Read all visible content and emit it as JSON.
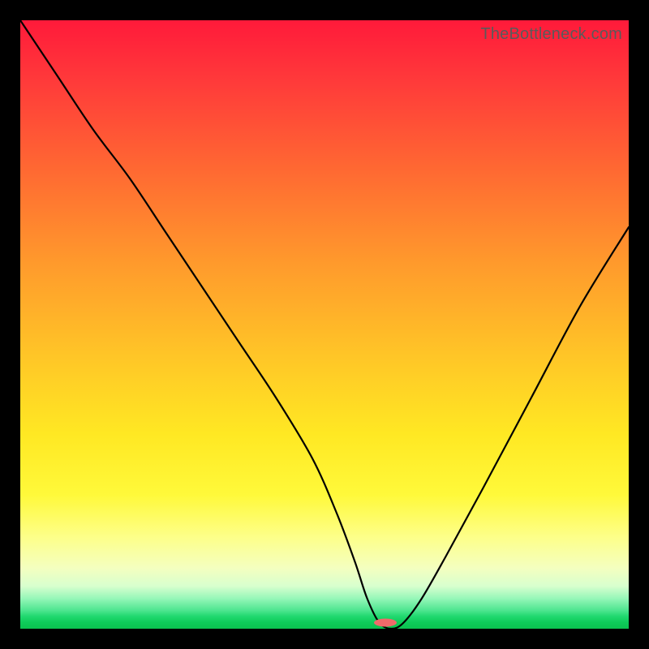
{
  "watermark": "TheBottleneck.com",
  "chart_data": {
    "type": "line",
    "title": "",
    "xlabel": "",
    "ylabel": "",
    "xlim": [
      0,
      100
    ],
    "ylim": [
      0,
      100
    ],
    "series": [
      {
        "name": "curve",
        "x": [
          0,
          6,
          12,
          18,
          24,
          30,
          36,
          42,
          48,
          52,
          55,
          57,
          59,
          61,
          63,
          66,
          70,
          76,
          84,
          92,
          100
        ],
        "values": [
          100,
          91,
          82,
          74,
          65,
          56,
          47,
          38,
          28,
          19,
          11,
          5,
          1,
          0,
          1,
          5,
          12,
          23,
          38,
          53,
          66
        ]
      }
    ],
    "marker": {
      "x": 60,
      "y": 1,
      "color": "#f06a6a",
      "rx": 14,
      "ry": 5
    },
    "gradient_stops": [
      {
        "pos": 0.0,
        "color": "#ff1a3a"
      },
      {
        "pos": 0.4,
        "color": "#ff9a2c"
      },
      {
        "pos": 0.78,
        "color": "#fff93a"
      },
      {
        "pos": 0.97,
        "color": "#4de58f"
      },
      {
        "pos": 1.0,
        "color": "#0bc24f"
      }
    ]
  }
}
